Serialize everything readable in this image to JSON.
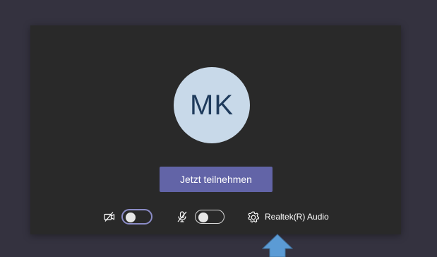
{
  "avatar": {
    "initials": "MK"
  },
  "join_button": {
    "label": "Jetzt teilnehmen"
  },
  "controls": {
    "video": {
      "icon": "video-off-icon",
      "state": "off"
    },
    "audio": {
      "icon": "mic-off-icon",
      "state": "off"
    },
    "device": {
      "icon": "gear-icon",
      "label": "Realtek(R) Audio"
    }
  },
  "annotation": {
    "icon": "blue-arrow-up",
    "color": "#5b9bd5"
  },
  "colors": {
    "page_background": "#34323f",
    "panel_background": "#292929",
    "avatar_background": "#c8d9e9",
    "avatar_text": "#1f3b5c",
    "accent": "#6264a7",
    "toggle_focus_border": "#8b8cc7"
  }
}
